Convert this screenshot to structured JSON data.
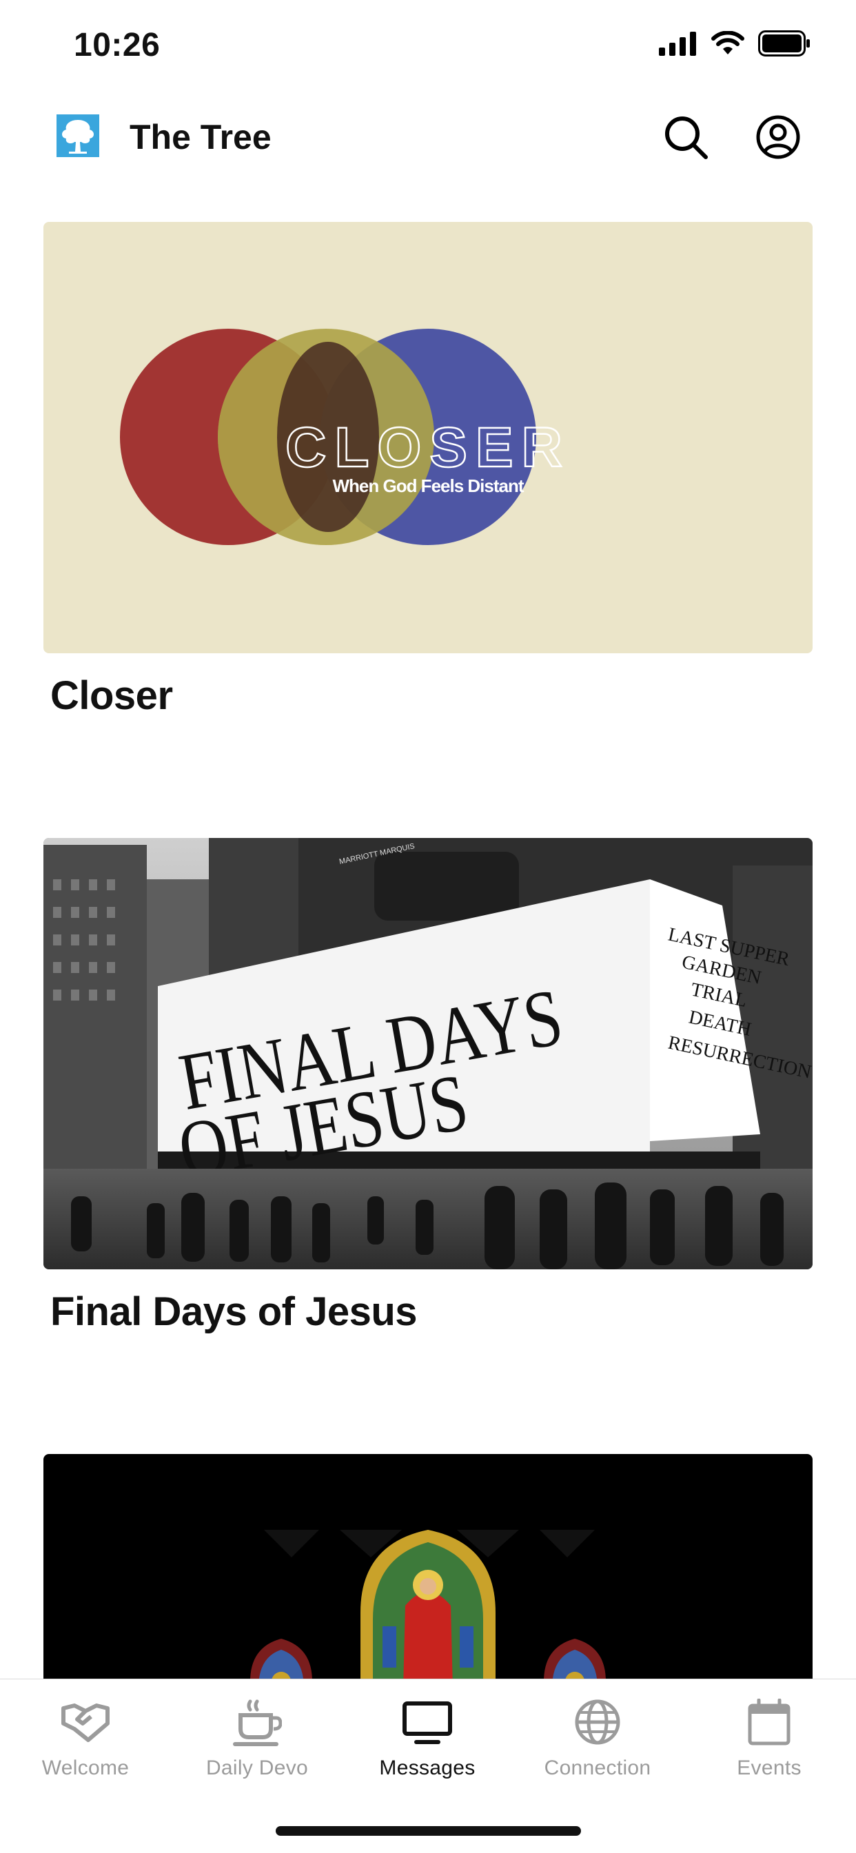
{
  "status": {
    "time": "10:26"
  },
  "header": {
    "title": "The Tree"
  },
  "cards": [
    {
      "title": "Closer",
      "art_title": "CLOSER",
      "art_subtitle": "When God Feels Distant"
    },
    {
      "title": "Final Days of Jesus",
      "art_line1": "FINAL DAYS",
      "art_line2": "OF JESUS",
      "art_list": [
        "LAST SUPPER",
        "GARDEN",
        "TRIAL",
        "DEATH",
        "RESURRECTION"
      ],
      "art_sign": "MARRIOTT MARQUIS"
    },
    {
      "title": ""
    }
  ],
  "tabs": [
    {
      "label": "Welcome",
      "icon": "handshake-icon",
      "active": false
    },
    {
      "label": "Daily Devo",
      "icon": "coffee-cup-icon",
      "active": false
    },
    {
      "label": "Messages",
      "icon": "tv-icon",
      "active": true
    },
    {
      "label": "Connection",
      "icon": "globe-icon",
      "active": false
    },
    {
      "label": "Events",
      "icon": "calendar-icon",
      "active": false
    }
  ],
  "colors": {
    "active_tab": "#111111",
    "inactive_tab": "#9b9b9b",
    "logo_blue": "#3aa6dd"
  }
}
